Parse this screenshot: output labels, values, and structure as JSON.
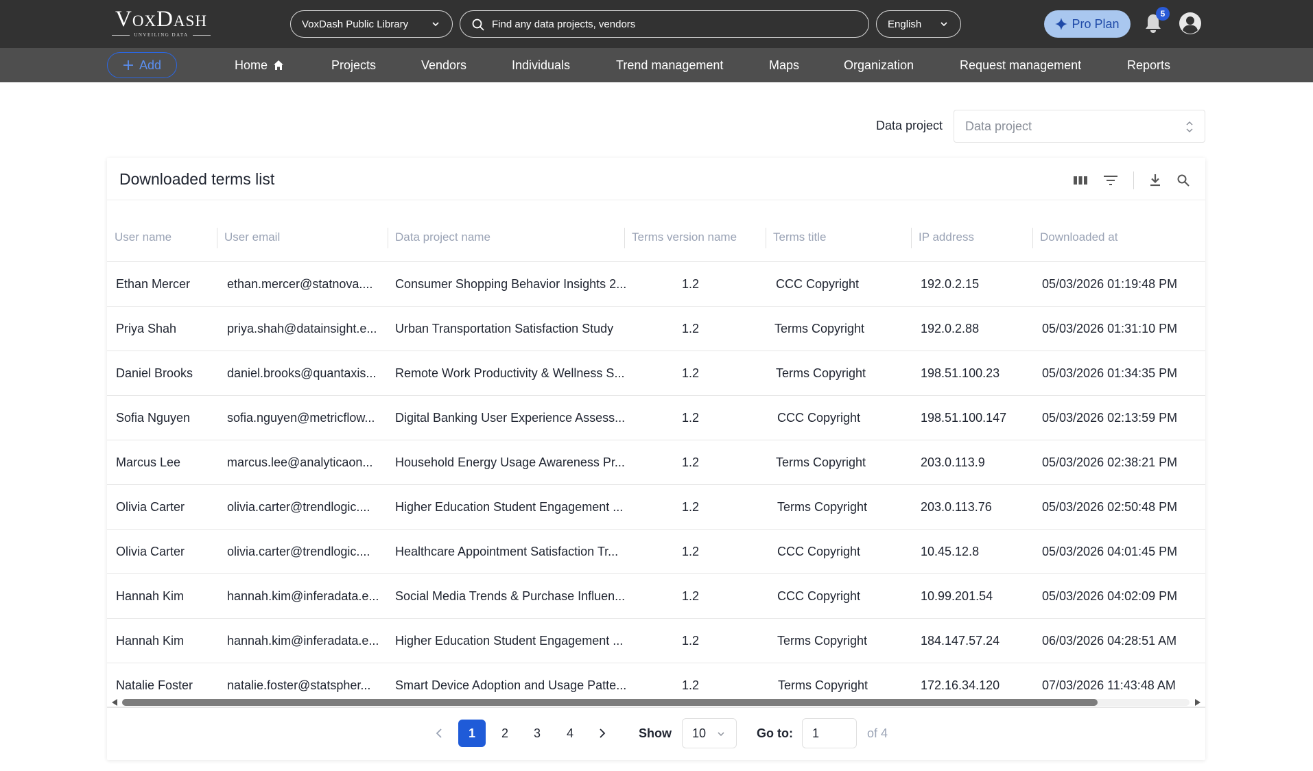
{
  "header": {
    "logo_text": "VoxDash",
    "logo_tagline": "UNVEILING DATA",
    "library_select": "VoxDash Public Library",
    "search_placeholder": "Find any data projects, vendors",
    "language": "English",
    "pro_label": "Pro Plan",
    "notification_count": "5"
  },
  "nav": {
    "add_label": "Add",
    "items": [
      "Home",
      "Projects",
      "Vendors",
      "Individuals",
      "Trend management",
      "Maps",
      "Organization",
      "Request management",
      "Reports"
    ]
  },
  "filter": {
    "label": "Data project",
    "placeholder": "Data project"
  },
  "table": {
    "title": "Downloaded terms list",
    "columns": [
      "User name",
      "User email",
      "Data project name",
      "Terms version name",
      "Terms title",
      "IP address",
      "Downloaded at"
    ],
    "rows": [
      [
        "Ethan Mercer",
        "ethan.mercer@statnova....",
        "Consumer Shopping Behavior Insights 2...",
        "1.2",
        "CCC Copyright",
        "192.0.2.15",
        "05/03/2026 01:19:48 PM"
      ],
      [
        "Priya Shah",
        "priya.shah@datainsight.e...",
        "Urban Transportation Satisfaction Study",
        "1.2",
        "Terms Copyright",
        "192.0.2.88",
        "05/03/2026 01:31:10 PM"
      ],
      [
        "Daniel Brooks",
        "daniel.brooks@quantaxis...",
        "Remote Work Productivity & Wellness S...",
        "1.2",
        "Terms Copyright",
        "198.51.100.23",
        "05/03/2026 01:34:35 PM"
      ],
      [
        "Sofia Nguyen",
        "sofia.nguyen@metricflow...",
        "Digital Banking User Experience Assess...",
        "1.2",
        "CCC Copyright",
        "198.51.100.147",
        "05/03/2026 02:13:59 PM"
      ],
      [
        "Marcus Lee",
        "marcus.lee@analyticaon...",
        "Household Energy Usage Awareness Pr...",
        "1.2",
        "Terms Copyright",
        "203.0.113.9",
        "05/03/2026 02:38:21 PM"
      ],
      [
        "Olivia Carter",
        "olivia.carter@trendlogic....",
        "Higher Education Student Engagement ...",
        "1.2",
        "Terms Copyright",
        "203.0.113.76",
        "05/03/2026 02:50:48 PM"
      ],
      [
        "Olivia Carter",
        "olivia.carter@trendlogic....",
        "Healthcare Appointment Satisfaction Tr...",
        "1.2",
        "CCC Copyright",
        "10.45.12.8",
        "05/03/2026 04:01:45 PM"
      ],
      [
        "Hannah Kim",
        "hannah.kim@inferadata.e...",
        "Social Media Trends & Purchase Influen...",
        "1.2",
        "CCC Copyright",
        "10.99.201.54",
        "05/03/2026 04:02:09 PM"
      ],
      [
        "Hannah Kim",
        "hannah.kim@inferadata.e...",
        "Higher Education Student Engagement ...",
        "1.2",
        "Terms Copyright",
        "184.147.57.24",
        "06/03/2026 04:28:51 AM"
      ],
      [
        "Natalie Foster",
        "natalie.foster@statspher...",
        "Smart Device Adoption and Usage Patte...",
        "1.2",
        "Terms Copyright",
        "172.16.34.120",
        "07/03/2026 11:43:48 AM"
      ]
    ]
  },
  "pagination": {
    "pages": [
      "1",
      "2",
      "3",
      "4"
    ],
    "current": "1",
    "show_label": "Show",
    "page_size": "10",
    "goto_label": "Go to:",
    "goto_value": "1",
    "of_label": "of 4"
  },
  "colors": {
    "topbar": "#323232",
    "navbar": "#4e4e4e",
    "accent": "#1f5bd8",
    "pro_bg": "#a9c7ef"
  }
}
